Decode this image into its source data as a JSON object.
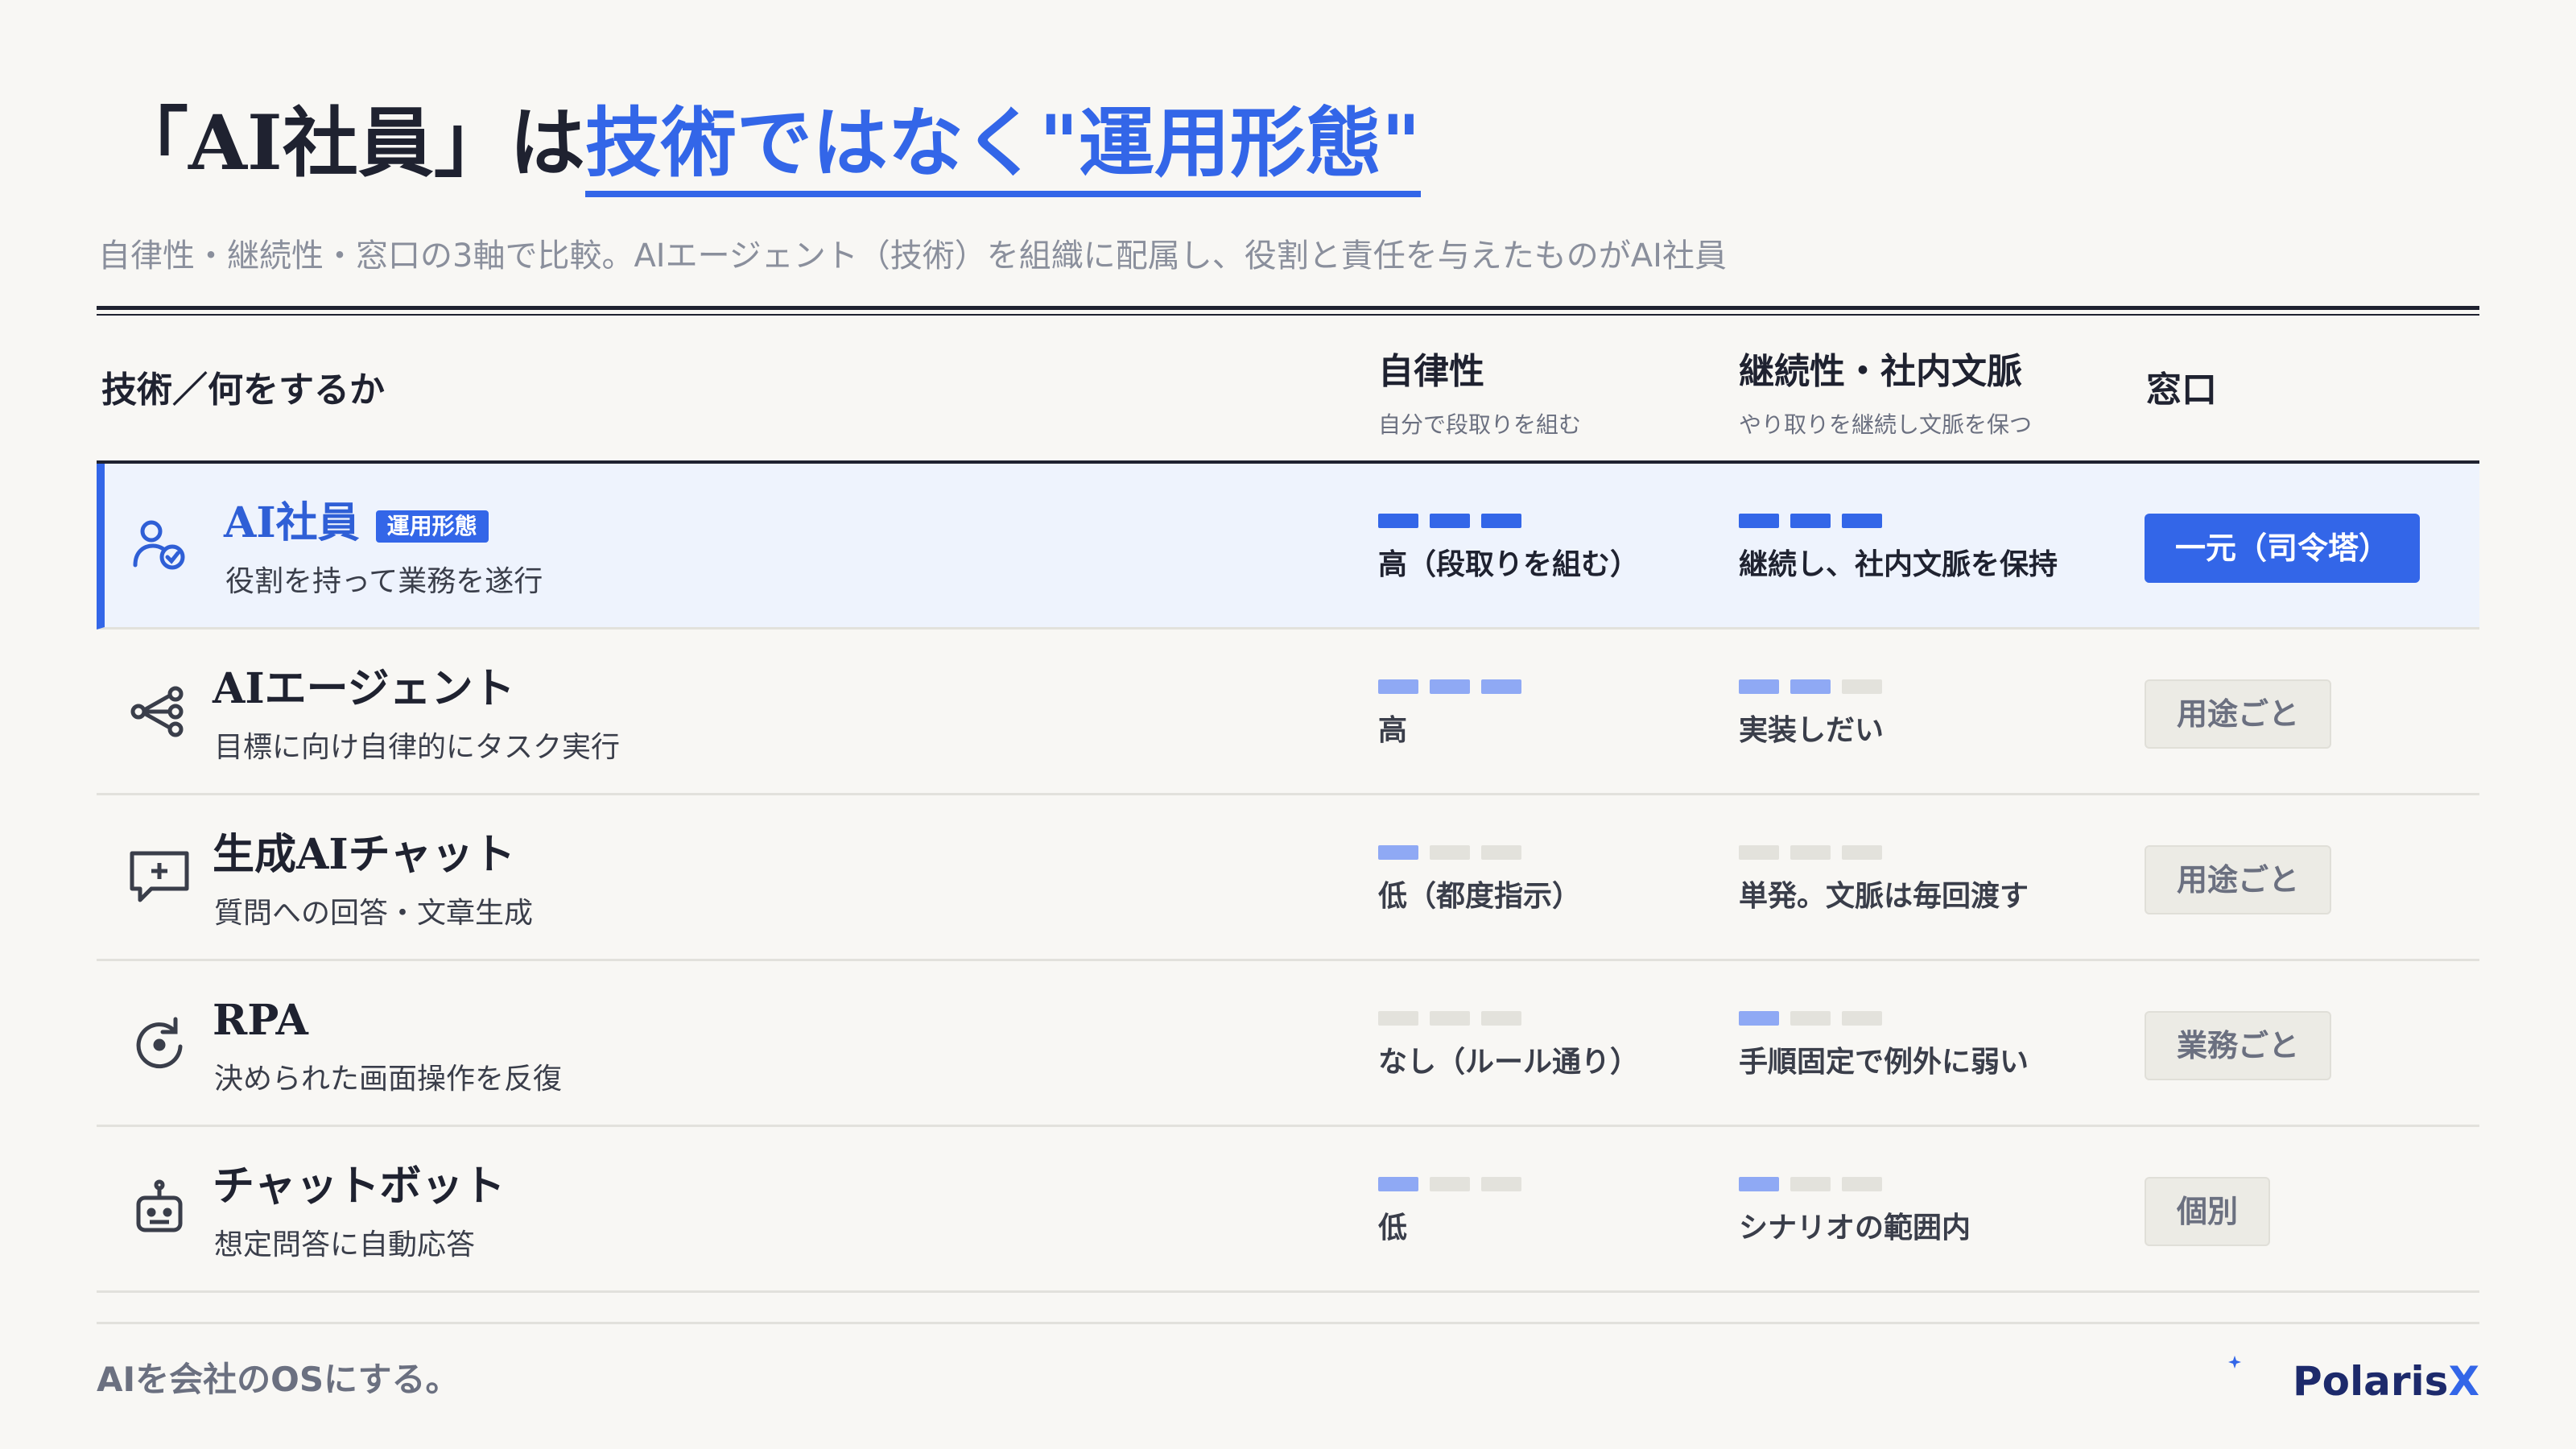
{
  "header": {
    "title_prefix": "「AI社員」は",
    "title_highlight": "技術ではなく\"運用形態\"",
    "subtitle": "自律性・継続性・窓口の3軸で比較。AIエージェント（技術）を組織に配属し、役割と責任を与えたものがAI社員"
  },
  "columns": {
    "tech": {
      "label": "技術／何をするか"
    },
    "autonomy": {
      "label": "自律性",
      "sub": "自分で段取りを組む"
    },
    "continuity": {
      "label": "継続性・社内文脈",
      "sub": "やり取りを継続し文脈を保つ"
    },
    "window": {
      "label": "窓口"
    }
  },
  "rows": [
    {
      "title": "AI社員",
      "badge": "運用形態",
      "desc": "役割を持って業務を遂行",
      "icon": "person-check-icon",
      "autonomy_level": 3,
      "autonomy_text": "高（段取りを組む）",
      "continuity_level": 3,
      "continuity_text": "継続し、社内文脈を保持",
      "window_text": "一元（司令塔）",
      "highlighted": true
    },
    {
      "title": "AIエージェント",
      "desc": "目標に向け自律的にタスク実行",
      "icon": "share-nodes-icon",
      "autonomy_level": 3,
      "autonomy_text": "高",
      "continuity_level": 2,
      "continuity_text": "実装しだい",
      "window_text": "用途ごと"
    },
    {
      "title": "生成AIチャット",
      "desc": "質問への回答・文章生成",
      "icon": "chat-sparkle-icon",
      "autonomy_level": 1,
      "autonomy_text": "低（都度指示）",
      "continuity_level": 0,
      "continuity_text": "単発。文脈は毎回渡す",
      "window_text": "用途ごと"
    },
    {
      "title": "RPA",
      "desc": "決められた画面操作を反復",
      "icon": "repeat-icon",
      "autonomy_level": 0,
      "autonomy_text": "なし（ルール通り）",
      "continuity_level": 1,
      "continuity_text": "手順固定で例外に弱い",
      "window_text": "業務ごと"
    },
    {
      "title": "チャットボット",
      "desc": "想定問答に自動応答",
      "icon": "robot-icon",
      "autonomy_level": 1,
      "autonomy_text": "低",
      "continuity_level": 1,
      "continuity_text": "シナリオの範囲内",
      "window_text": "個別"
    }
  ],
  "footer": {
    "tagline": "AIを会社のOSにする。",
    "logo_main": "Polaris",
    "logo_accent": "X"
  },
  "colors": {
    "accent": "#3366e8",
    "accent_soft": "#8fa9f4",
    "bar_off": "#e3e2dc",
    "background": "#f8f7f4",
    "text": "#1f2230"
  }
}
